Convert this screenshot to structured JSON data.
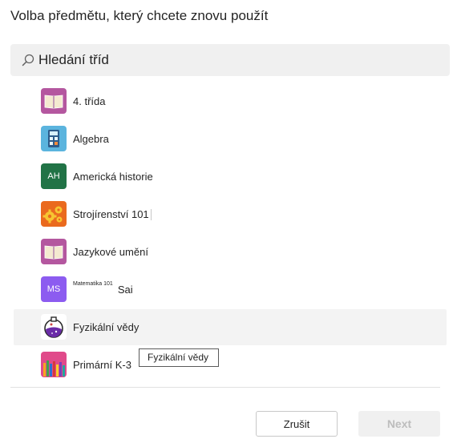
{
  "dialog": {
    "title": "Volba předmětu, který chcete znovu použít"
  },
  "search": {
    "placeholder": "Hledání tříd",
    "icon": "search-icon"
  },
  "classes": [
    {
      "label": "4. třída",
      "icon": "book-icon",
      "color": "#b4579f"
    },
    {
      "label": "Algebra",
      "icon": "calculator-icon",
      "color": "#5bb4de"
    },
    {
      "label": "Americká historie",
      "initials": "AH",
      "color": "#217346"
    },
    {
      "label": "Strojírenství 101",
      "icon": "gears-icon",
      "color": "#ea6a1e"
    },
    {
      "label": "Jazykové umění",
      "icon": "book-icon",
      "color": "#b4579f"
    },
    {
      "label_small": "Matematika 101",
      "label_suffix": "Sai",
      "initials": "MS",
      "color": "#8c5cf0"
    },
    {
      "label": "Fyzikální vědy",
      "icon": "flask-icon",
      "color": "#ffffff",
      "selected": true
    },
    {
      "label": "Primární K-3",
      "icon": "pencils-icon",
      "color": "#e04a8a"
    }
  ],
  "tooltip": {
    "text": "Fyzikální vědy"
  },
  "footer": {
    "cancel_label": "Zrušit",
    "next_label": "Next"
  }
}
